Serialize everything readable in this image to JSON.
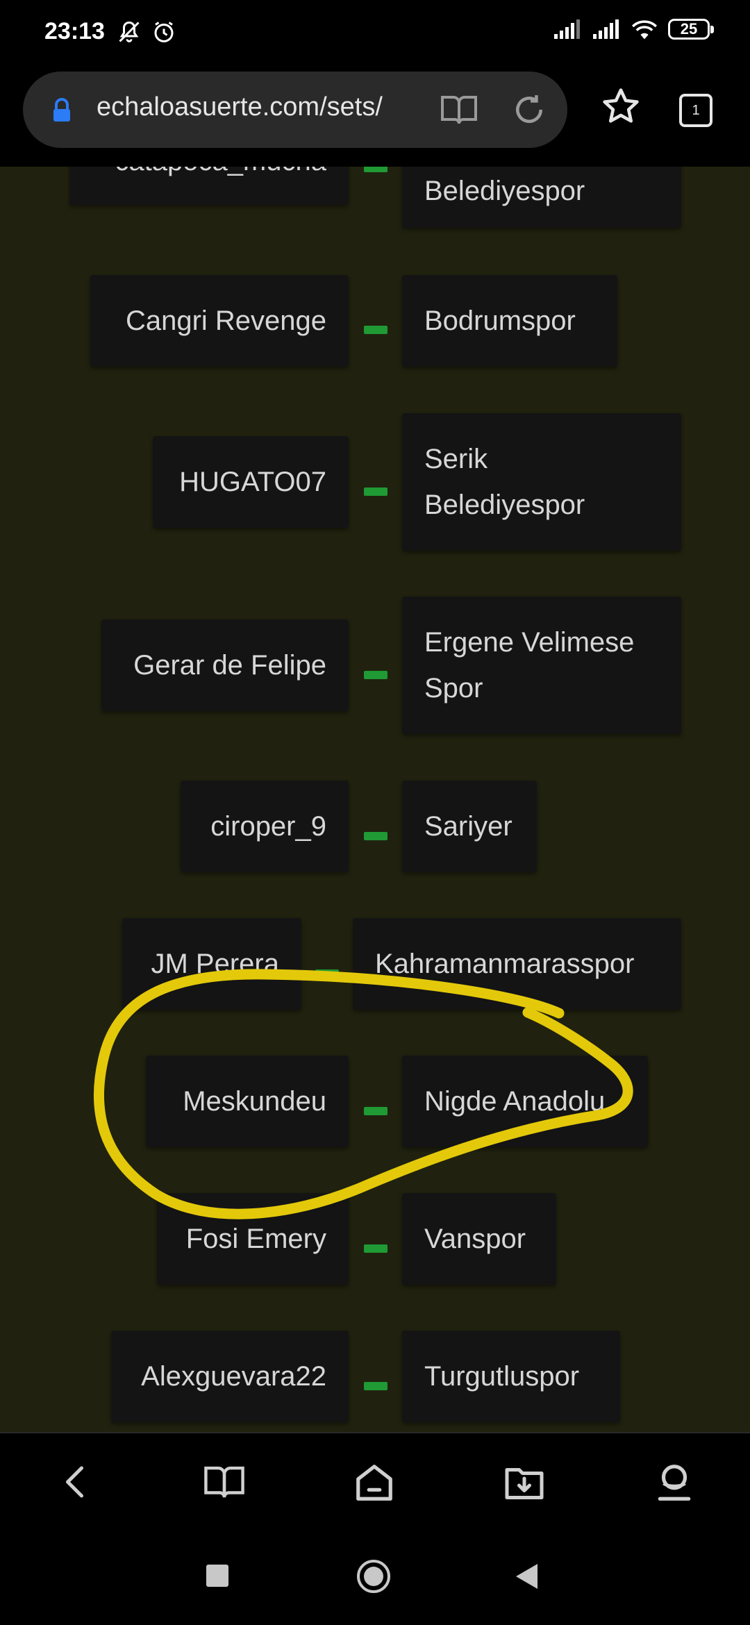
{
  "status_bar": {
    "time": "23:13",
    "battery": "25"
  },
  "browser": {
    "url": "echaloasuerte.com/sets/",
    "tab_count": "1"
  },
  "pairs": [
    {
      "left": "catapoca_mucha",
      "right": "Belediyespor"
    },
    {
      "left": "Cangri Revenge",
      "right": "Bodrumspor"
    },
    {
      "left": "HUGATO07",
      "right": "Serik Belediyespor"
    },
    {
      "left": "Gerar de Felipe",
      "right": "Ergene Velimese Spor"
    },
    {
      "left": "ciroper_9",
      "right": "Sariyer"
    },
    {
      "left": "JM Perera",
      "right": "Kahramanmarasspor"
    },
    {
      "left": "Meskundeu",
      "right": "Nigde Anadolu"
    },
    {
      "left": "Fosi Emery",
      "right": "Vanspor"
    },
    {
      "left": "Alexguevara22",
      "right": "Turgutluspor"
    }
  ],
  "colors": {
    "page_background": "#20220f",
    "box_background": "#141414",
    "dash": "#1f9a34",
    "highlight_stroke": "#e3c90a"
  }
}
